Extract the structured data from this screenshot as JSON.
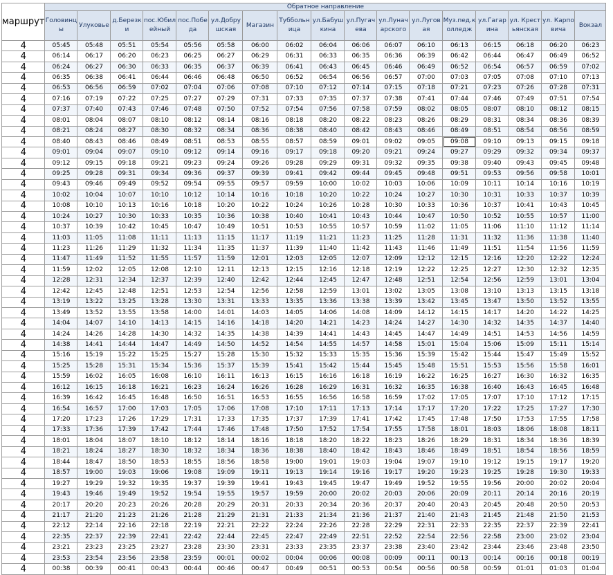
{
  "route_header": "маршрут",
  "direction_title": "Обратное направление",
  "selected_cell": {
    "row": 9,
    "col": 12
  },
  "stops": [
    "Головинцы",
    "Улуковье",
    "д.Березки",
    "пос.Юбилейный",
    "пос.Победа",
    "ул.Добрушская",
    "Магазин",
    "Тубболь­ница",
    "ул.Бабушкина",
    "ул.Пугачева",
    "ул.Луначарского",
    "ул.Луговая",
    "Муз.пед.колледж",
    "ул.Гагарина",
    "ул. Крестьянская",
    "ул. Карповича",
    "Вокзал"
  ],
  "rows": [
    {
      "route": "4",
      "times": [
        "05:45",
        "05:48",
        "05:51",
        "05:54",
        "05:56",
        "05:58",
        "06:00",
        "06:02",
        "06:04",
        "06:06",
        "06:07",
        "06:10",
        "06:13",
        "06:15",
        "06:18",
        "06:20",
        "06:23"
      ]
    },
    {
      "route": "4",
      "times": [
        "06:14",
        "06:17",
        "06:20",
        "06:23",
        "06:25",
        "06:27",
        "06:29",
        "06:31",
        "06:33",
        "06:35",
        "06:36",
        "06:39",
        "06:42",
        "06:44",
        "06:47",
        "06:49",
        "06:52"
      ]
    },
    {
      "route": "4",
      "times": [
        "06:24",
        "06:27",
        "06:30",
        "06:33",
        "06:35",
        "06:37",
        "06:39",
        "06:41",
        "06:43",
        "06:45",
        "06:46",
        "06:49",
        "06:52",
        "06:54",
        "06:57",
        "06:59",
        "07:02"
      ]
    },
    {
      "route": "4",
      "times": [
        "06:35",
        "06:38",
        "06:41",
        "06:44",
        "06:46",
        "06:48",
        "06:50",
        "06:52",
        "06:54",
        "06:56",
        "06:57",
        "07:00",
        "07:03",
        "07:05",
        "07:08",
        "07:10",
        "07:13"
      ]
    },
    {
      "route": "4",
      "times": [
        "06:53",
        "06:56",
        "06:59",
        "07:02",
        "07:04",
        "07:06",
        "07:08",
        "07:10",
        "07:12",
        "07:14",
        "07:15",
        "07:18",
        "07:21",
        "07:23",
        "07:26",
        "07:28",
        "07:31"
      ]
    },
    {
      "route": "4",
      "times": [
        "07:16",
        "07:19",
        "07:22",
        "07:25",
        "07:27",
        "07:29",
        "07:31",
        "07:33",
        "07:35",
        "07:37",
        "07:38",
        "07:41",
        "07:44",
        "07:46",
        "07:49",
        "07:51",
        "07:54"
      ]
    },
    {
      "route": "4",
      "times": [
        "07:37",
        "07:40",
        "07:43",
        "07:46",
        "07:48",
        "07:50",
        "07:52",
        "07:54",
        "07:56",
        "07:58",
        "07:59",
        "08:02",
        "08:05",
        "08:07",
        "08:10",
        "08:12",
        "08:15"
      ]
    },
    {
      "route": "4",
      "times": [
        "08:01",
        "08:04",
        "08:07",
        "08:10",
        "08:12",
        "08:14",
        "08:16",
        "08:18",
        "08:20",
        "08:22",
        "08:23",
        "08:26",
        "08:29",
        "08:31",
        "08:34",
        "08:36",
        "08:39"
      ]
    },
    {
      "route": "4",
      "times": [
        "08:21",
        "08:24",
        "08:27",
        "08:30",
        "08:32",
        "08:34",
        "08:36",
        "08:38",
        "08:40",
        "08:42",
        "08:43",
        "08:46",
        "08:49",
        "08:51",
        "08:54",
        "08:56",
        "08:59"
      ]
    },
    {
      "route": "4",
      "times": [
        "08:40",
        "08:43",
        "08:46",
        "08:49",
        "08:51",
        "08:53",
        "08:55",
        "08:57",
        "08:59",
        "09:01",
        "09:02",
        "09:05",
        "09:08",
        "09:10",
        "09:13",
        "09:15",
        "09:18"
      ]
    },
    {
      "route": "4",
      "times": [
        "09:01",
        "09:04",
        "09:07",
        "09:10",
        "09:12",
        "09:14",
        "09:16",
        "09:17",
        "09:18",
        "09:20",
        "09:21",
        "09:24",
        "09:27",
        "09:29",
        "09:32",
        "09:34",
        "09:37"
      ]
    },
    {
      "route": "4",
      "times": [
        "09:12",
        "09:15",
        "09:18",
        "09:21",
        "09:23",
        "09:24",
        "09:26",
        "09:28",
        "09:29",
        "09:31",
        "09:32",
        "09:35",
        "09:38",
        "09:40",
        "09:43",
        "09:45",
        "09:48"
      ]
    },
    {
      "route": "4",
      "times": [
        "09:25",
        "09:28",
        "09:31",
        "09:34",
        "09:36",
        "09:37",
        "09:39",
        "09:41",
        "09:42",
        "09:44",
        "09:45",
        "09:48",
        "09:51",
        "09:53",
        "09:56",
        "09:58",
        "10:01"
      ]
    },
    {
      "route": "4",
      "times": [
        "09:43",
        "09:46",
        "09:49",
        "09:52",
        "09:54",
        "09:55",
        "09:57",
        "09:59",
        "10:00",
        "10:02",
        "10:03",
        "10:06",
        "10:09",
        "10:11",
        "10:14",
        "10:16",
        "10:19"
      ]
    },
    {
      "route": "4",
      "times": [
        "10:02",
        "10:04",
        "10:07",
        "10:10",
        "10:12",
        "10:14",
        "10:16",
        "10:18",
        "10:20",
        "10:22",
        "10:24",
        "10:27",
        "10:30",
        "10:31",
        "10:33",
        "10:37",
        "10:39"
      ]
    },
    {
      "route": "4",
      "times": [
        "10:08",
        "10:10",
        "10:13",
        "10:16",
        "10:18",
        "10:20",
        "10:22",
        "10:24",
        "10:26",
        "10:28",
        "10:30",
        "10:33",
        "10:36",
        "10:37",
        "10:41",
        "10:43",
        "10:45"
      ]
    },
    {
      "route": "4",
      "times": [
        "10:24",
        "10:27",
        "10:30",
        "10:33",
        "10:35",
        "10:36",
        "10:38",
        "10:40",
        "10:41",
        "10:43",
        "10:44",
        "10:47",
        "10:50",
        "10:52",
        "10:55",
        "10:57",
        "11:00"
      ]
    },
    {
      "route": "4",
      "times": [
        "10:37",
        "10:39",
        "10:42",
        "10:45",
        "10:47",
        "10:49",
        "10:51",
        "10:53",
        "10:55",
        "10:57",
        "10:59",
        "11:02",
        "11:05",
        "11:06",
        "11:10",
        "11:12",
        "11:14"
      ]
    },
    {
      "route": "4",
      "times": [
        "11:03",
        "11:05",
        "11:08",
        "11:11",
        "11:13",
        "11:15",
        "11:17",
        "11:19",
        "11:21",
        "11:23",
        "11:25",
        "11:28",
        "11:31",
        "11:32",
        "11:36",
        "11:38",
        "11:40"
      ]
    },
    {
      "route": "4",
      "times": [
        "11:23",
        "11:26",
        "11:29",
        "11:32",
        "11:34",
        "11:35",
        "11:37",
        "11:39",
        "11:40",
        "11:42",
        "11:43",
        "11:46",
        "11:49",
        "11:51",
        "11:54",
        "11:56",
        "11:59"
      ]
    },
    {
      "route": "4",
      "times": [
        "11:47",
        "11:49",
        "11:52",
        "11:55",
        "11:57",
        "11:59",
        "12:01",
        "12:03",
        "12:05",
        "12:07",
        "12:09",
        "12:12",
        "12:15",
        "12:16",
        "12:20",
        "12:22",
        "12:24"
      ]
    },
    {
      "route": "4",
      "times": [
        "11:59",
        "12:02",
        "12:05",
        "12:08",
        "12:10",
        "12:11",
        "12:13",
        "12:15",
        "12:16",
        "12:18",
        "12:19",
        "12:22",
        "12:25",
        "12:27",
        "12:30",
        "12:32",
        "12:35"
      ]
    },
    {
      "route": "4",
      "times": [
        "12:28",
        "12:31",
        "12:34",
        "12:37",
        "12:39",
        "12:40",
        "12:42",
        "12:44",
        "12:45",
        "12:47",
        "12:48",
        "12:51",
        "12:54",
        "12:56",
        "12:59",
        "13:01",
        "13:04"
      ]
    },
    {
      "route": "4",
      "times": [
        "12:42",
        "12:45",
        "12:48",
        "12:51",
        "12:53",
        "12:54",
        "12:56",
        "12:58",
        "12:59",
        "13:01",
        "13:02",
        "13:05",
        "13:08",
        "13:10",
        "13:13",
        "13:15",
        "13:18"
      ]
    },
    {
      "route": "4",
      "times": [
        "13:19",
        "13:22",
        "13:25",
        "13:28",
        "13:30",
        "13:31",
        "13:33",
        "13:35",
        "13:36",
        "13:38",
        "13:39",
        "13:42",
        "13:45",
        "13:47",
        "13:50",
        "13:52",
        "13:55"
      ]
    },
    {
      "route": "4",
      "times": [
        "13:49",
        "13:52",
        "13:55",
        "13:58",
        "14:00",
        "14:01",
        "14:03",
        "14:05",
        "14:06",
        "14:08",
        "14:09",
        "14:12",
        "14:15",
        "14:17",
        "14:20",
        "14:22",
        "14:25"
      ]
    },
    {
      "route": "4",
      "times": [
        "14:04",
        "14:07",
        "14:10",
        "14:13",
        "14:15",
        "14:16",
        "14:18",
        "14:20",
        "14:21",
        "14:23",
        "14:24",
        "14:27",
        "14:30",
        "14:32",
        "14:35",
        "14:37",
        "14:40"
      ]
    },
    {
      "route": "4",
      "times": [
        "14:24",
        "14:26",
        "14:28",
        "14:30",
        "14:32",
        "14:35",
        "14:38",
        "14:39",
        "14:41",
        "14:43",
        "14:45",
        "14:47",
        "14:49",
        "14:51",
        "14:53",
        "14:56",
        "14:59"
      ]
    },
    {
      "route": "4",
      "times": [
        "14:38",
        "14:41",
        "14:44",
        "14:47",
        "14:49",
        "14:50",
        "14:52",
        "14:54",
        "14:55",
        "14:57",
        "14:58",
        "15:01",
        "15:04",
        "15:06",
        "15:09",
        "15:11",
        "15:14"
      ]
    },
    {
      "route": "4",
      "times": [
        "15:16",
        "15:19",
        "15:22",
        "15:25",
        "15:27",
        "15:28",
        "15:30",
        "15:32",
        "15:33",
        "15:35",
        "15:36",
        "15:39",
        "15:42",
        "15:44",
        "15:47",
        "15:49",
        "15:52"
      ]
    },
    {
      "route": "4",
      "times": [
        "15:25",
        "15:28",
        "15:31",
        "15:34",
        "15:36",
        "15:37",
        "15:39",
        "15:41",
        "15:42",
        "15:44",
        "15:45",
        "15:48",
        "15:51",
        "15:53",
        "15:56",
        "15:58",
        "16:01"
      ]
    },
    {
      "route": "4",
      "times": [
        "15:59",
        "16:02",
        "16:05",
        "16:08",
        "16:10",
        "16:11",
        "16:13",
        "16:15",
        "16:16",
        "16:18",
        "16:19",
        "16:22",
        "16:25",
        "16:27",
        "16:30",
        "16:32",
        "16:35"
      ]
    },
    {
      "route": "4",
      "times": [
        "16:12",
        "16:15",
        "16:18",
        "16:21",
        "16:23",
        "16:24",
        "16:26",
        "16:28",
        "16:29",
        "16:31",
        "16:32",
        "16:35",
        "16:38",
        "16:40",
        "16:43",
        "16:45",
        "16:48"
      ]
    },
    {
      "route": "4",
      "times": [
        "16:39",
        "16:42",
        "16:45",
        "16:48",
        "16:50",
        "16:51",
        "16:53",
        "16:55",
        "16:56",
        "16:58",
        "16:59",
        "17:02",
        "17:05",
        "17:07",
        "17:10",
        "17:12",
        "17:15"
      ]
    },
    {
      "route": "4",
      "times": [
        "16:54",
        "16:57",
        "17:00",
        "17:03",
        "17:05",
        "17:06",
        "17:08",
        "17:10",
        "17:11",
        "17:13",
        "17:14",
        "17:17",
        "17:20",
        "17:22",
        "17:25",
        "17:27",
        "17:30"
      ]
    },
    {
      "route": "4",
      "times": [
        "17:20",
        "17:23",
        "17:26",
        "17:29",
        "17:31",
        "17:33",
        "17:35",
        "17:37",
        "17:39",
        "17:41",
        "17:42",
        "17:45",
        "17:48",
        "17:50",
        "17:53",
        "17:55",
        "17:58"
      ]
    },
    {
      "route": "4",
      "times": [
        "17:33",
        "17:36",
        "17:39",
        "17:42",
        "17:44",
        "17:46",
        "17:48",
        "17:50",
        "17:52",
        "17:54",
        "17:55",
        "17:58",
        "18:01",
        "18:03",
        "18:06",
        "18:08",
        "18:11"
      ]
    },
    {
      "route": "4",
      "times": [
        "18:01",
        "18:04",
        "18:07",
        "18:10",
        "18:12",
        "18:14",
        "18:16",
        "18:18",
        "18:20",
        "18:22",
        "18:23",
        "18:26",
        "18:29",
        "18:31",
        "18:34",
        "18:36",
        "18:39"
      ]
    },
    {
      "route": "4",
      "times": [
        "18:21",
        "18:24",
        "18:27",
        "18:30",
        "18:32",
        "18:34",
        "18:36",
        "18:38",
        "18:40",
        "18:42",
        "18:43",
        "18:46",
        "18:49",
        "18:51",
        "18:54",
        "18:56",
        "18:59"
      ]
    },
    {
      "route": "4",
      "times": [
        "18:44",
        "18:47",
        "18:50",
        "18:53",
        "18:55",
        "18:56",
        "18:58",
        "19:00",
        "19:01",
        "19:03",
        "19:04",
        "19:07",
        "19:10",
        "19:12",
        "19:15",
        "19:17",
        "19:20"
      ]
    },
    {
      "route": "4",
      "times": [
        "18:57",
        "19:00",
        "19:03",
        "19:06",
        "19:08",
        "19:09",
        "19:11",
        "19:13",
        "19:14",
        "19:16",
        "19:17",
        "19:20",
        "19:23",
        "19:25",
        "19:28",
        "19:30",
        "19:33"
      ]
    },
    {
      "route": "4",
      "times": [
        "19:27",
        "19:29",
        "19:32",
        "19:35",
        "19:37",
        "19:39",
        "19:41",
        "19:43",
        "19:45",
        "19:47",
        "19:49",
        "19:52",
        "19:55",
        "19:56",
        "20:00",
        "20:02",
        "20:04"
      ]
    },
    {
      "route": "4",
      "times": [
        "19:43",
        "19:46",
        "19:49",
        "19:52",
        "19:54",
        "19:55",
        "19:57",
        "19:59",
        "20:00",
        "20:02",
        "20:03",
        "20:06",
        "20:09",
        "20:11",
        "20:14",
        "20:16",
        "20:19"
      ]
    },
    {
      "route": "4",
      "times": [
        "20:17",
        "20:20",
        "20:23",
        "20:26",
        "20:28",
        "20:29",
        "20:31",
        "20:33",
        "20:34",
        "20:36",
        "20:37",
        "20:40",
        "20:43",
        "20:45",
        "20:48",
        "20:50",
        "20:53"
      ]
    },
    {
      "route": "4",
      "times": [
        "21:17",
        "21:20",
        "21:23",
        "21:26",
        "21:28",
        "21:29",
        "21:31",
        "21:33",
        "21:34",
        "21:36",
        "21:37",
        "21:40",
        "21:43",
        "21:45",
        "21:48",
        "21:50",
        "21:53"
      ]
    },
    {
      "route": "4",
      "times": [
        "22:12",
        "22:14",
        "22:16",
        "22:18",
        "22:19",
        "22:21",
        "22:22",
        "22:24",
        "22:26",
        "22:28",
        "22:29",
        "22:31",
        "22:33",
        "22:35",
        "22:37",
        "22:39",
        "22:41"
      ]
    },
    {
      "route": "4",
      "times": [
        "22:35",
        "22:37",
        "22:39",
        "22:41",
        "22:42",
        "22:44",
        "22:45",
        "22:47",
        "22:49",
        "22:51",
        "22:52",
        "22:54",
        "22:56",
        "22:58",
        "23:00",
        "23:02",
        "23:04"
      ]
    },
    {
      "route": "4",
      "times": [
        "23:21",
        "23:23",
        "23:25",
        "23:27",
        "23:28",
        "23:30",
        "23:31",
        "23:33",
        "23:35",
        "23:37",
        "23:38",
        "23:40",
        "23:42",
        "23:44",
        "23:46",
        "23:48",
        "23:50"
      ]
    },
    {
      "route": "4",
      "times": [
        "23:53",
        "23:54",
        "23:56",
        "23:58",
        "23:59",
        "00:01",
        "00:02",
        "00:04",
        "00:06",
        "00:08",
        "00:09",
        "00:11",
        "00:13",
        "00:14",
        "00:16",
        "00:18",
        "00:19"
      ]
    },
    {
      "route": "4",
      "times": [
        "00:38",
        "00:39",
        "00:41",
        "00:43",
        "00:44",
        "00:46",
        "00:47",
        "00:49",
        "00:51",
        "00:53",
        "00:54",
        "00:56",
        "00:58",
        "00:59",
        "01:01",
        "01:03",
        "01:04"
      ]
    }
  ]
}
